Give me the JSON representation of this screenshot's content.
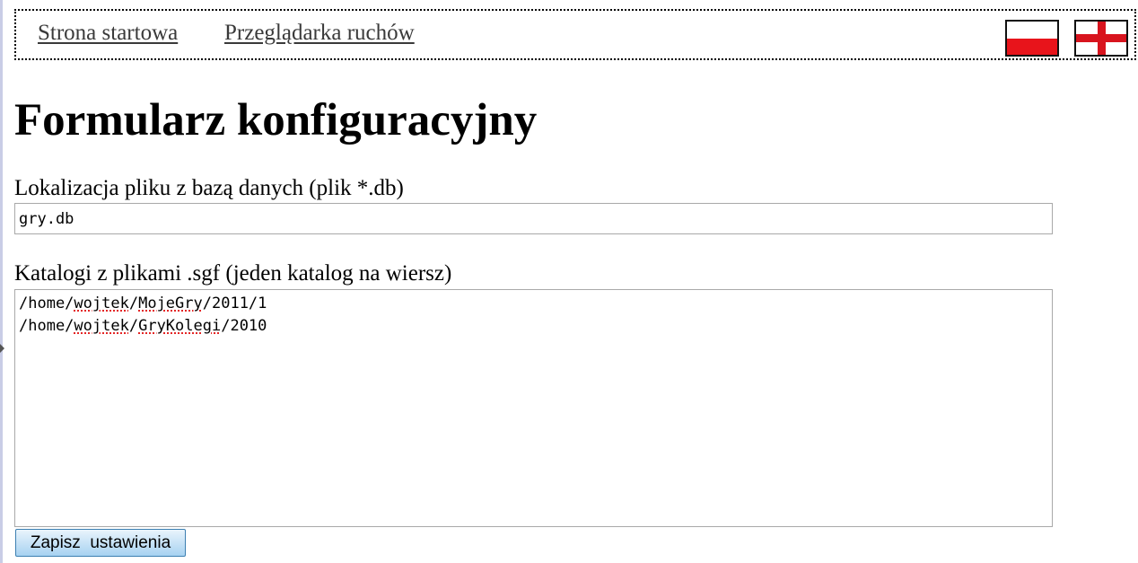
{
  "nav": {
    "home_label": "Strona startowa",
    "browser_label": "Przeglądarka ruchów"
  },
  "languages": [
    {
      "code": "pl",
      "icon": "flag-poland-icon"
    },
    {
      "code": "en",
      "icon": "flag-england-icon"
    }
  ],
  "page": {
    "title": "Formularz konfiguracyjny"
  },
  "form": {
    "db_label": "Lokalizacja pliku z bazą danych (plik *.db)",
    "db_value": "gry.db",
    "dirs_label": "Katalogi z plikami .sgf (jeden katalog na wiersz)",
    "dirs": [
      {
        "pre": "/home/",
        "w1": "wojtek",
        "mid": "/",
        "w2": "MojeGry",
        "post": "/2011/1"
      },
      {
        "pre": "/home/",
        "w1": "wojtek",
        "mid": "/",
        "w2": "GryKolegi",
        "post": "/2010"
      }
    ],
    "save_label": "Zapisz  ustawienia"
  },
  "colors": {
    "flag_red": "#e8141b",
    "button_border": "#3c7fb1",
    "button_top": "#e9f4fc",
    "button_bottom": "#a7d2f1",
    "spellcheck": "#e00000"
  }
}
